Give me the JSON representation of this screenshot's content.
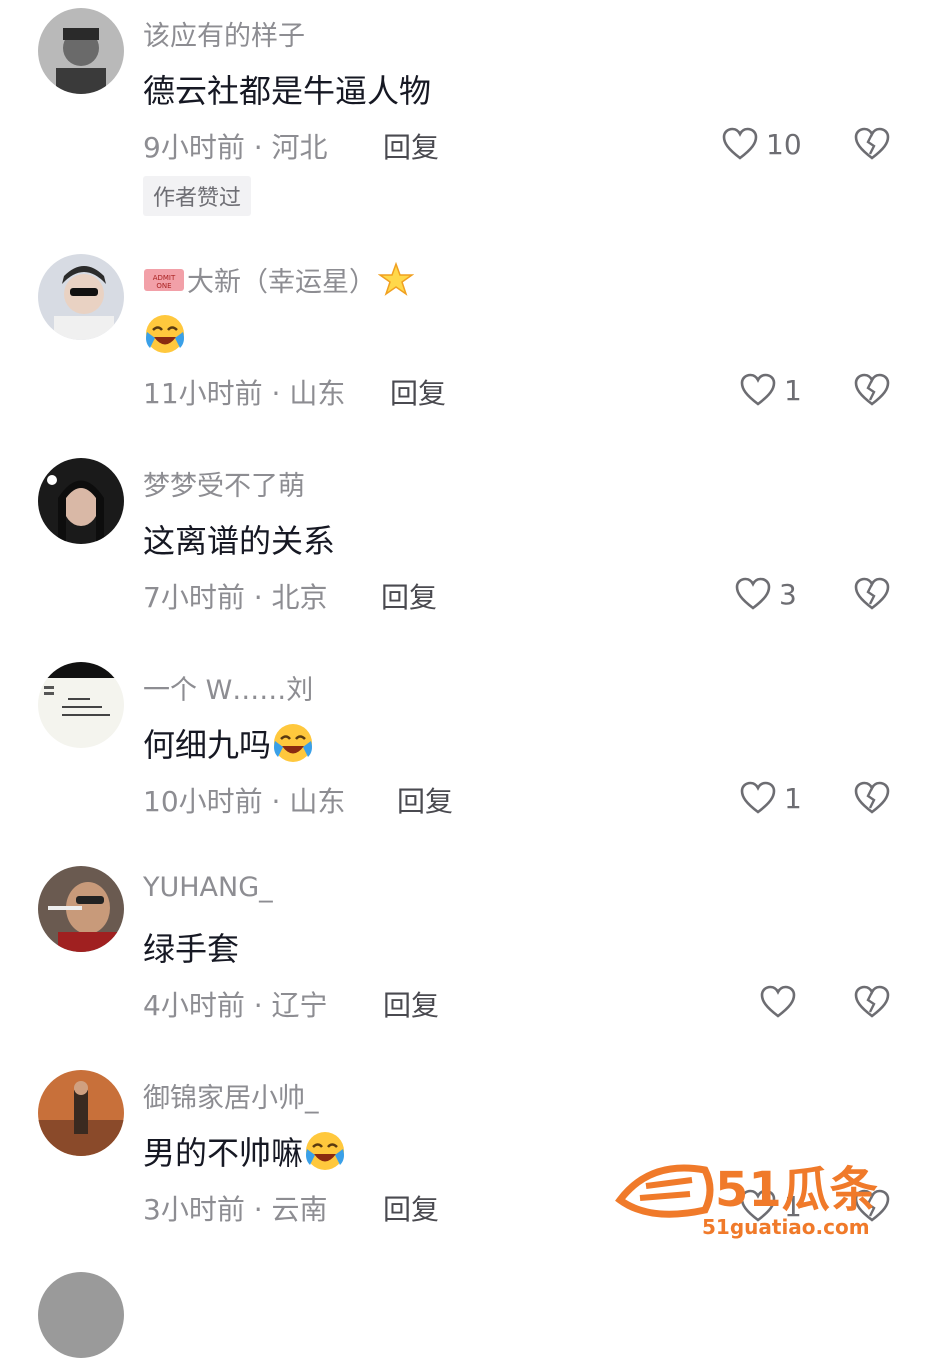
{
  "comments": [
    {
      "username": "该应有的样子",
      "text": "德云社都是牛逼人物",
      "time": "9小时前",
      "location": "河北",
      "separator": " · ",
      "reply": "回复",
      "likes": "10",
      "badge": "作者赞过",
      "has_badge": true,
      "emoji": false
    },
    {
      "username": "大新（幸运星）",
      "text": "",
      "time": "11小时前",
      "location": "山东",
      "separator": " · ",
      "reply": "回复",
      "likes": "1",
      "badge": "",
      "has_badge": false,
      "emoji": true
    },
    {
      "username": "梦梦受不了萌",
      "text": "这离谱的关系",
      "time": "7小时前",
      "location": "北京",
      "separator": " · ",
      "reply": "回复",
      "likes": "3",
      "badge": "",
      "has_badge": false,
      "emoji": false
    },
    {
      "username": "一个 W……刘",
      "text": "何细九吗",
      "time": "10小时前",
      "location": "山东",
      "separator": " · ",
      "reply": "回复",
      "likes": "1",
      "badge": "",
      "has_badge": false,
      "emoji": true
    },
    {
      "username": "YUHANG_",
      "text": "绿手套",
      "time": "4小时前",
      "location": "辽宁",
      "separator": " · ",
      "reply": "回复",
      "likes": "",
      "badge": "",
      "has_badge": false,
      "emoji": false
    },
    {
      "username": "御锦家居小帅_",
      "text": "男的不帅嘛",
      "time": "3小时前",
      "location": "云南",
      "separator": " · ",
      "reply": "回复",
      "likes": "1",
      "badge": "",
      "has_badge": false,
      "emoji": true
    }
  ],
  "icons": {
    "like": "heart-outline-icon",
    "dislike": "broken-heart-icon",
    "emoji": "crying-laughing-emoji"
  },
  "watermark": {
    "brand": "51瓜条",
    "url": "51guatiao.com",
    "color": "#f07a2a"
  },
  "colors": {
    "text": "#161823",
    "muted": "#8d8d92",
    "reply": "#4a4a50"
  }
}
